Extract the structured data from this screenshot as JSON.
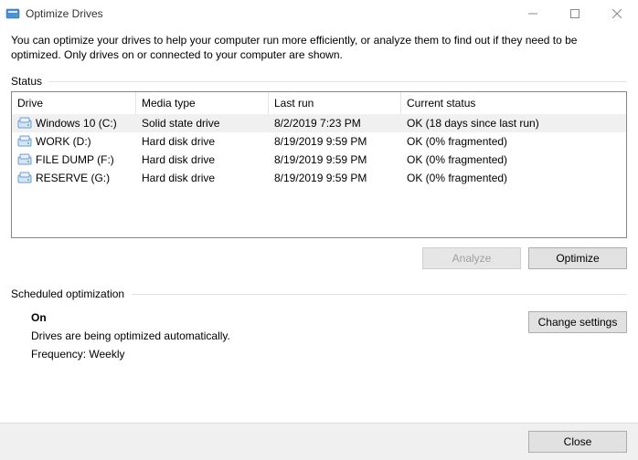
{
  "window": {
    "title": "Optimize Drives"
  },
  "description": "You can optimize your drives to help your computer run more efficiently, or analyze them to find out if they need to be optimized. Only drives on or connected to your computer are shown.",
  "sections": {
    "status_label": "Status",
    "sched_label": "Scheduled optimization"
  },
  "columns": {
    "drive": "Drive",
    "media": "Media type",
    "lastrun": "Last run",
    "status": "Current status"
  },
  "drives": [
    {
      "name": "Windows 10 (C:)",
      "media": "Solid state drive",
      "lastrun": "8/2/2019 7:23 PM",
      "status": "OK (18 days since last run)"
    },
    {
      "name": "WORK (D:)",
      "media": "Hard disk drive",
      "lastrun": "8/19/2019 9:59 PM",
      "status": "OK (0% fragmented)"
    },
    {
      "name": "FILE DUMP (F:)",
      "media": "Hard disk drive",
      "lastrun": "8/19/2019 9:59 PM",
      "status": "OK (0% fragmented)"
    },
    {
      "name": "RESERVE (G:)",
      "media": "Hard disk drive",
      "lastrun": "8/19/2019 9:59 PM",
      "status": "OK (0% fragmented)"
    }
  ],
  "buttons": {
    "analyze": "Analyze",
    "optimize": "Optimize",
    "change_settings": "Change settings",
    "close": "Close"
  },
  "schedule": {
    "state": "On",
    "desc": "Drives are being optimized automatically.",
    "freq_label": "Frequency:",
    "freq_value": "Weekly"
  }
}
